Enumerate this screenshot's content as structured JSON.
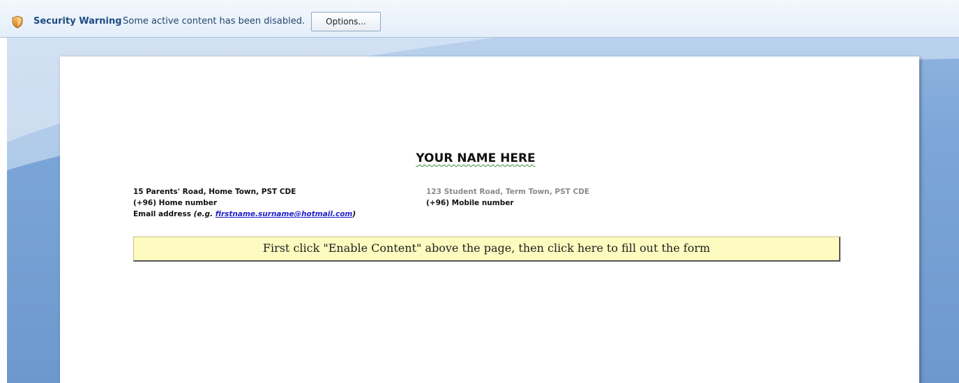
{
  "message_bar": {
    "icon": "shield-warning-icon",
    "title": "Security Warning",
    "message": "Some active content has been disabled.",
    "options_label": "Options..."
  },
  "document": {
    "name_heading": "YOUR NAME HERE",
    "home": {
      "address": "15 Parents' Road, Home Town, PST CDE",
      "phone_prefix": "(+96)",
      "phone_label": "Home number",
      "email_label": "Email address",
      "email_hint_prefix": "(e.g.",
      "email_example": "firstname.surname@hotmail.com",
      "email_hint_suffix": ")"
    },
    "term": {
      "address": "123 Student Road, Term Town, PST CDE",
      "phone_prefix": "(+96)",
      "phone_label": "Mobile number"
    },
    "fill_form_button": "First click \"Enable Content\" above the page, then click here to fill out the form"
  },
  "colors": {
    "message_bar_bg": "#e4eef9",
    "workspace_bg": "#7ca6d8",
    "button_fill": "#fdfbbf",
    "link": "#2222cc"
  }
}
